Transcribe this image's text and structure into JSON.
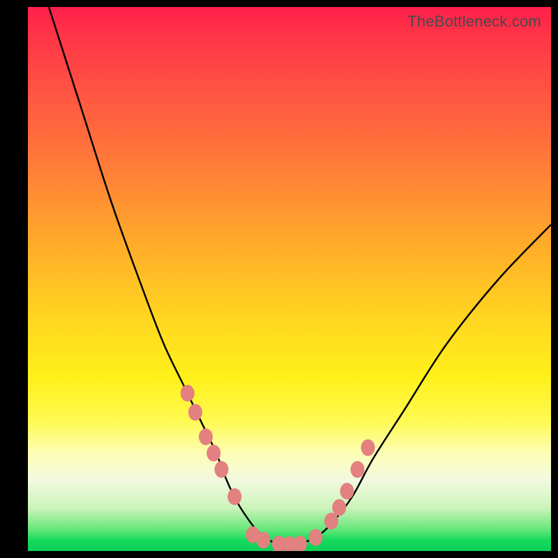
{
  "watermark": "TheBottleneck.com",
  "colors": {
    "frame": "#000000",
    "curve": "#000000",
    "marker": "#e38080",
    "gradient_top": "#ff1f4a",
    "gradient_bottom": "#0bd058"
  },
  "chart_data": {
    "type": "line",
    "title": "",
    "xlabel": "",
    "ylabel": "",
    "xlim": [
      0,
      100
    ],
    "ylim": [
      0,
      100
    ],
    "grid": false,
    "legend": false,
    "series": [
      {
        "name": "bottleneck-curve",
        "x": [
          4,
          10,
          16,
          22,
          26,
          30,
          33,
          36,
          38,
          40,
          42,
          44,
          46,
          48,
          50,
          52,
          55,
          58,
          62,
          66,
          72,
          80,
          90,
          100
        ],
        "values": [
          100,
          82,
          64,
          48,
          38,
          30,
          24,
          18,
          13,
          9,
          6,
          3.5,
          2,
          1.4,
          1.2,
          1.4,
          2.5,
          5,
          10,
          17,
          26,
          38,
          50,
          60
        ]
      }
    ],
    "markers": {
      "name": "highlight-points",
      "x": [
        30.5,
        32,
        34,
        35.5,
        37,
        39.5,
        43,
        45,
        48,
        50,
        52,
        55,
        58,
        59.5,
        61,
        63,
        65
      ],
      "values": [
        29,
        25.5,
        21,
        18,
        15,
        10,
        3,
        2,
        1.3,
        1.2,
        1.3,
        2.5,
        5.5,
        8,
        11,
        15,
        19
      ]
    }
  }
}
